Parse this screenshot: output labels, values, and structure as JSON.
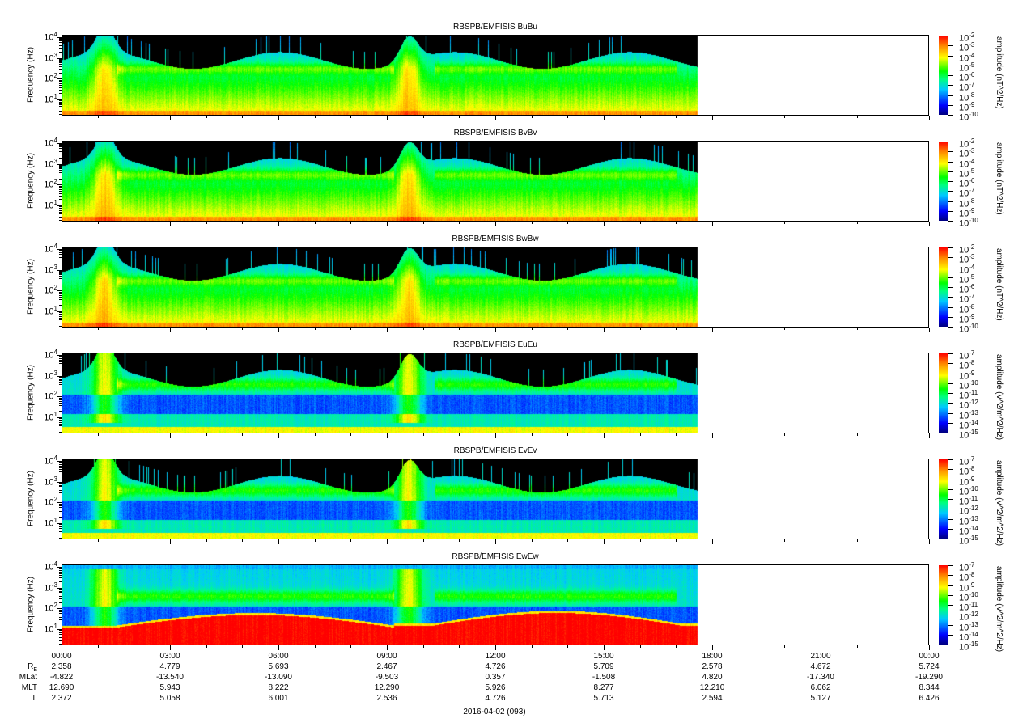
{
  "chart_data": {
    "type": "heatmap",
    "xlabel": "2016-04-02 (093)",
    "x_tick_labels": [
      "00:00",
      "03:00",
      "06:00",
      "09:00",
      "12:00",
      "15:00",
      "18:00",
      "21:00",
      "00:00"
    ],
    "x_range_hours": [
      0,
      24
    ],
    "data_coverage_hours": [
      0,
      17.6
    ],
    "ylabel": "Frequency (Hz)",
    "ylim": [
      1.7,
      13000
    ],
    "yscale": "log",
    "y_tick_exponents": [
      1,
      2,
      3,
      4
    ],
    "panels": [
      {
        "title": "RBSPB/EMFISIS  BuBu",
        "colorbar_label": "amplitude (nT^2/Hz)",
        "cbar_exponents": [
          -2,
          -3,
          -4,
          -5,
          -6,
          -7,
          -8,
          -9,
          -10
        ],
        "kind": "B"
      },
      {
        "title": "RBSPB/EMFISIS  BvBv",
        "colorbar_label": "amplitude (nT^2/Hz)",
        "cbar_exponents": [
          -2,
          -3,
          -4,
          -5,
          -6,
          -7,
          -8,
          -9,
          -10
        ],
        "kind": "B"
      },
      {
        "title": "RBSPB/EMFISIS  BwBw",
        "colorbar_label": "amplitude (nT^2/Hz)",
        "cbar_exponents": [
          -2,
          -3,
          -4,
          -5,
          -6,
          -7,
          -8,
          -9,
          -10
        ],
        "kind": "B"
      },
      {
        "title": "RBSPB/EMFISIS  EuEu",
        "colorbar_label": "amplitude (V^2/m^2/Hz)",
        "cbar_exponents": [
          -7,
          -8,
          -9,
          -10,
          -11,
          -12,
          -13,
          -14,
          -15
        ],
        "kind": "E"
      },
      {
        "title": "RBSPB/EMFISIS  EvEv",
        "colorbar_label": "amplitude (V^2/m^2/Hz)",
        "cbar_exponents": [
          -7,
          -8,
          -9,
          -10,
          -11,
          -12,
          -13,
          -14,
          -15
        ],
        "kind": "E"
      },
      {
        "title": "RBSPB/EMFISIS  EwEw",
        "colorbar_label": "amplitude (V^2/m^2/Hz)",
        "cbar_exponents": [
          -7,
          -8,
          -9,
          -10,
          -11,
          -12,
          -13,
          -14,
          -15
        ],
        "kind": "Ew"
      }
    ],
    "ephemeris": {
      "labels": {
        "re": "R",
        "re_sub": "E",
        "mlat": "MLat",
        "mlt": "MLT",
        "l": "L"
      },
      "RE": [
        "2.358",
        "4.779",
        "5.693",
        "2.467",
        "4.726",
        "5.709",
        "2.578",
        "4.672",
        "5.724"
      ],
      "MLat": [
        "-4.822",
        "-13.540",
        "-13.090",
        "-9.503",
        "0.357",
        "-1.508",
        "4.820",
        "-17.340",
        "-19.290"
      ],
      "MLT": [
        "12.690",
        "5.943",
        "8.222",
        "12.290",
        "5.926",
        "8.277",
        "12.210",
        "6.062",
        "8.344"
      ],
      "L": [
        "2.372",
        "5.058",
        "6.001",
        "2.536",
        "4.726",
        "5.713",
        "2.594",
        "5.127",
        "6.426"
      ]
    }
  }
}
